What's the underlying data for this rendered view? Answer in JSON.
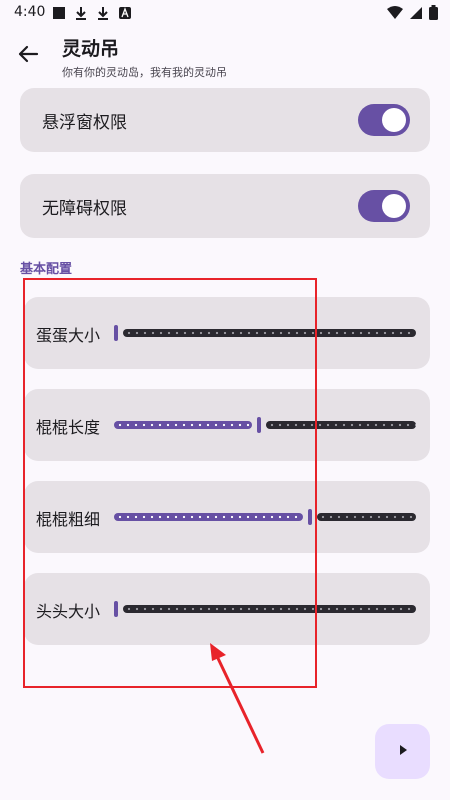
{
  "status_bar": {
    "time": "4:40",
    "left_icons": [
      "stop-square-icon",
      "download-icon",
      "download-icon",
      "app-notification-icon"
    ],
    "right_icons": [
      "wifi-icon",
      "cell-signal-icon",
      "battery-icon"
    ]
  },
  "app_bar": {
    "title": "灵动吊",
    "subtitle": "你有你的灵动岛，我有我的灵动吊",
    "back_icon": "arrow-back-icon"
  },
  "permissions": [
    {
      "label": "悬浮窗权限",
      "enabled": true
    },
    {
      "label": "无障碍权限",
      "enabled": true
    }
  ],
  "section": {
    "title": "基本配置"
  },
  "sliders": [
    {
      "label": "蛋蛋大小",
      "value_fraction": 0.0
    },
    {
      "label": "棍棍长度",
      "value_fraction": 0.48
    },
    {
      "label": "棍棍粗细",
      "value_fraction": 0.65
    },
    {
      "label": "头头大小",
      "value_fraction": 0.0
    }
  ],
  "fab": {
    "icon": "play-icon"
  },
  "annotation": {
    "color": "#e8232a"
  },
  "colors": {
    "accent": "#6750a4",
    "card": "#e6e1e6",
    "background": "#fbf8fd"
  }
}
